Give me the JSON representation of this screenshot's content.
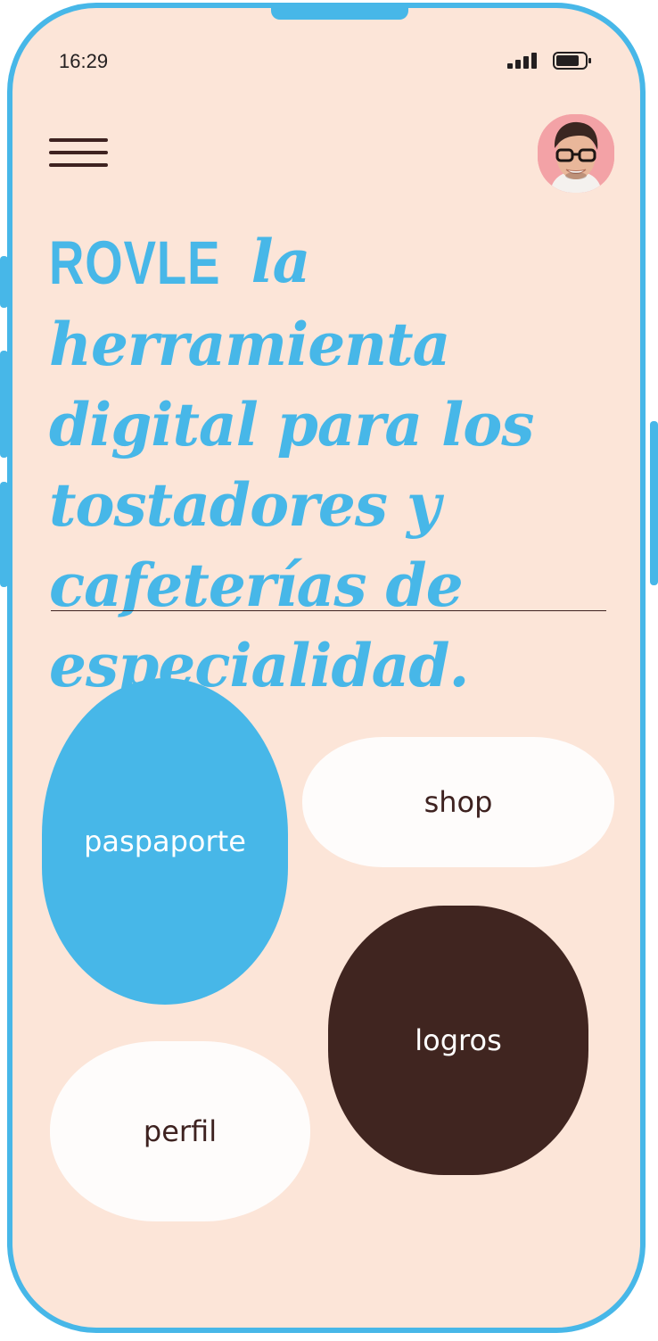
{
  "status_bar": {
    "time": "16:29",
    "signal_icon": "signal-bars-icon",
    "battery_icon": "battery-icon"
  },
  "header": {
    "menu_icon": "hamburger-menu-icon",
    "avatar": "user-avatar"
  },
  "hero": {
    "brand": "ROVLE",
    "tagline": "la herramienta digital para los tostadores y cafeterías de especialidad."
  },
  "nav": {
    "pasaporte_label": "paspaporte",
    "shop_label": "shop",
    "logros_label": "logros",
    "perfil_label": "perfil"
  },
  "colors": {
    "background": "#fce5d8",
    "accent_blue": "#47b7e8",
    "dark_brown": "#402520",
    "white": "#fefcfb"
  }
}
